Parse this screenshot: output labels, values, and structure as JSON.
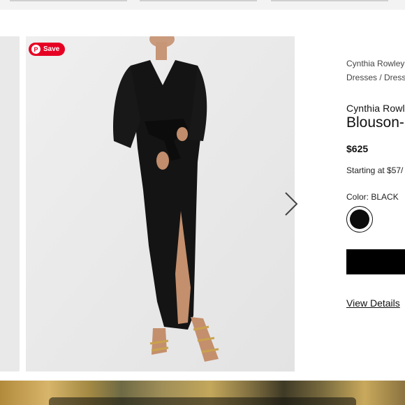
{
  "pin_save": {
    "label": "Save",
    "icon": "pinterest-icon",
    "color": "#e60023"
  },
  "product": {
    "breadcrumb_brand": "Cynthia Rowley",
    "breadcrumb_category": "Dresses / Dress",
    "brand": "Cynthia Rowle",
    "name": "Blouson-S",
    "price": "$625",
    "financing": "Starting at $57/",
    "color_label": "Color: BLACK",
    "color_swatch": "#0d0d0d",
    "view_details": "View Details"
  },
  "icons": {
    "next": "chevron-right-icon"
  }
}
